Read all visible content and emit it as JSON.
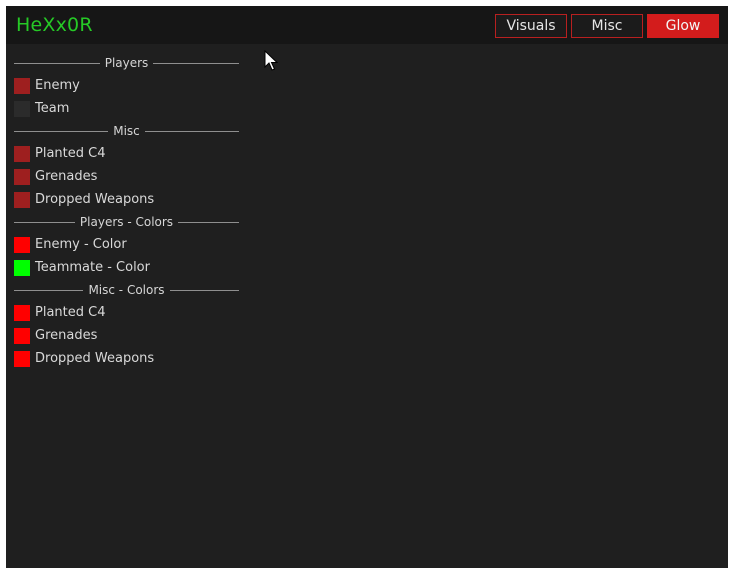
{
  "app": {
    "title": "HeXx0R"
  },
  "tabs": [
    {
      "label": "Visuals",
      "active": false
    },
    {
      "label": "Misc",
      "active": false
    },
    {
      "label": "Glow",
      "active": true
    }
  ],
  "sections": [
    {
      "title": "Players",
      "items": [
        {
          "label": "Enemy",
          "kind": "checkbox",
          "checked": true,
          "color": "#9e1f1f"
        },
        {
          "label": "Team",
          "kind": "checkbox",
          "checked": false,
          "color": "#2b2b2b"
        }
      ]
    },
    {
      "title": "Misc",
      "items": [
        {
          "label": "Planted C4",
          "kind": "checkbox",
          "checked": true,
          "color": "#9e1f1f"
        },
        {
          "label": "Grenades",
          "kind": "checkbox",
          "checked": true,
          "color": "#9e1f1f"
        },
        {
          "label": "Dropped Weapons",
          "kind": "checkbox",
          "checked": true,
          "color": "#9e1f1f"
        }
      ]
    },
    {
      "title": "Players - Colors",
      "items": [
        {
          "label": "Enemy - Color",
          "kind": "color",
          "color": "#ff0000"
        },
        {
          "label": "Teammate - Color",
          "kind": "color",
          "color": "#00ff00"
        }
      ]
    },
    {
      "title": "Misc - Colors",
      "items": [
        {
          "label": "Planted C4",
          "kind": "color",
          "color": "#ff0000"
        },
        {
          "label": "Grenades",
          "kind": "color",
          "color": "#ff0000"
        },
        {
          "label": "Dropped Weapons",
          "kind": "color",
          "color": "#ff0000"
        }
      ]
    }
  ],
  "theme": {
    "window_bg": "#1f1f1f",
    "titlebar_bg": "#161616",
    "title_color": "#26c926",
    "accent": "#d31c1c"
  }
}
